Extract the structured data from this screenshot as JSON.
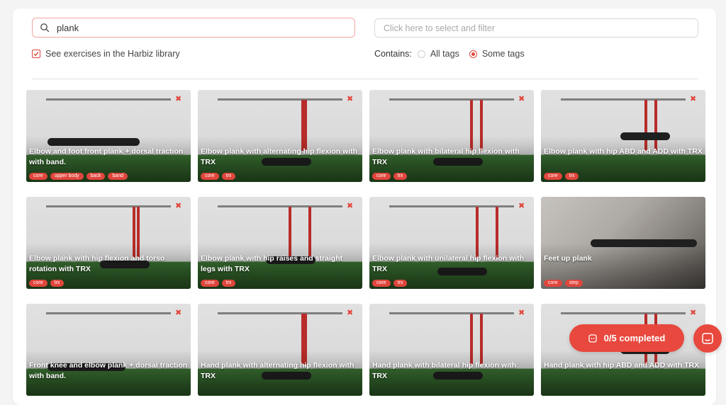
{
  "search": {
    "value": "plank"
  },
  "filter": {
    "placeholder": "Click here to select and filter"
  },
  "library": {
    "label": "See exercises in the Harbiz library",
    "checked": true
  },
  "contains": {
    "label": "Contains:",
    "options": [
      {
        "label": "All tags",
        "selected": false
      },
      {
        "label": "Some tags",
        "selected": true
      }
    ]
  },
  "accent_color": "#e0463d",
  "exercises": [
    {
      "title": "Elbow and foot front plank + dorsal traction with band.",
      "tags": [
        "core",
        "upper body",
        "back",
        "band"
      ]
    },
    {
      "title": "Elbow plank with alternating hip flexion with TRX",
      "tags": [
        "core",
        "trx"
      ]
    },
    {
      "title": "Elbow plank with bilateral hip flexion with TRX",
      "tags": [
        "core",
        "trx"
      ]
    },
    {
      "title": "Elbow plank with hip ABD and ADD with TRX",
      "tags": [
        "core",
        "trx"
      ]
    },
    {
      "title": "Elbow plank with hip flexion and torso rotation with TRX",
      "tags": [
        "core",
        "trx"
      ]
    },
    {
      "title": "Elbow plank with hip raises and straight legs with TRX",
      "tags": [
        "core",
        "trx"
      ]
    },
    {
      "title": "Elbow plank with unilateral hip flexion with TRX",
      "tags": [
        "core",
        "trx"
      ]
    },
    {
      "title": "Feet up plank",
      "tags": [
        "core",
        "step"
      ]
    },
    {
      "title": "Front knee and elbow plank + dorsal traction with band.",
      "tags": []
    },
    {
      "title": "Hand plank with alternating hip flexion with TRX",
      "tags": []
    },
    {
      "title": "Hand plank with bilateral hip flexion with TRX",
      "tags": []
    },
    {
      "title": "Hand plank with hip ABD and ADD with TRX",
      "tags": []
    }
  ],
  "progress": {
    "label": "0/5 completed"
  }
}
